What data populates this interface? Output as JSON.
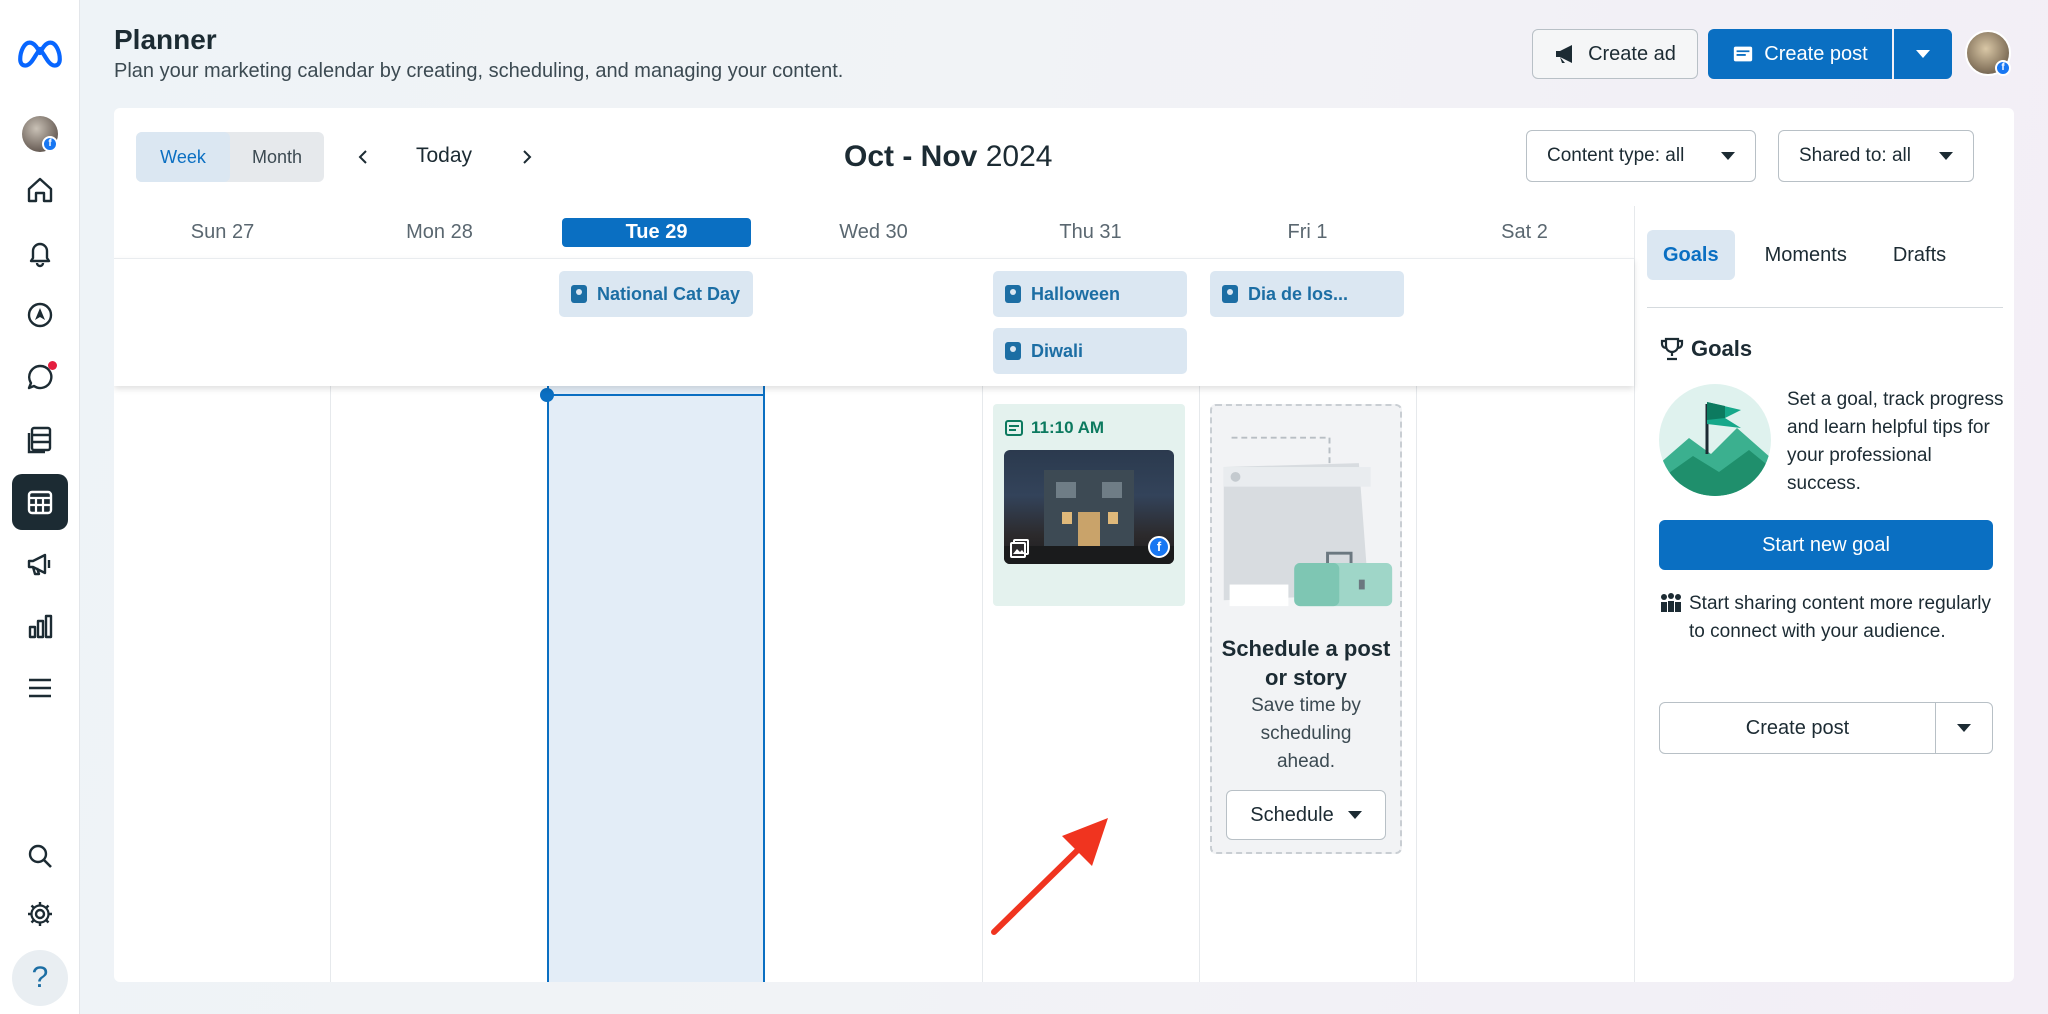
{
  "header": {
    "title": "Planner",
    "subtitle": "Plan your marketing calendar by creating, scheduling, and managing your content.",
    "create_ad": "Create ad",
    "create_post": "Create post"
  },
  "toolbar": {
    "view_week": "Week",
    "view_month": "Month",
    "today": "Today",
    "range_months": "Oct - Nov",
    "range_year": "2024",
    "content_type": "Content type: all",
    "shared_to": "Shared to: all"
  },
  "days": [
    {
      "label": "Sun 27"
    },
    {
      "label": "Mon 28"
    },
    {
      "label": "Tue 29"
    },
    {
      "label": "Wed 30"
    },
    {
      "label": "Thu 31"
    },
    {
      "label": "Fri 1"
    },
    {
      "label": "Sat 2"
    }
  ],
  "moments": {
    "cat_day": "National Cat Day",
    "halloween": "Halloween",
    "diwali": "Diwali",
    "dia": "Dia de los..."
  },
  "post": {
    "time": "11:10 AM"
  },
  "schedule_card": {
    "title": "Schedule a post or story",
    "subtitle": "Save time by scheduling ahead.",
    "button": "Schedule"
  },
  "side": {
    "tabs": [
      "Goals",
      "Moments",
      "Drafts"
    ],
    "goals_heading": "Goals",
    "goals_text": "Set a goal, track progress and learn helpful tips for your professional success.",
    "start_goal": "Start new goal",
    "share_text": "Start sharing content more regularly to connect with your audience.",
    "create_post": "Create post"
  },
  "colors": {
    "accent": "#0a6fc2",
    "moment_bg": "#dbe7f2",
    "post_bg": "#e4f2ee",
    "annotation_arrow": "#f0341f"
  }
}
